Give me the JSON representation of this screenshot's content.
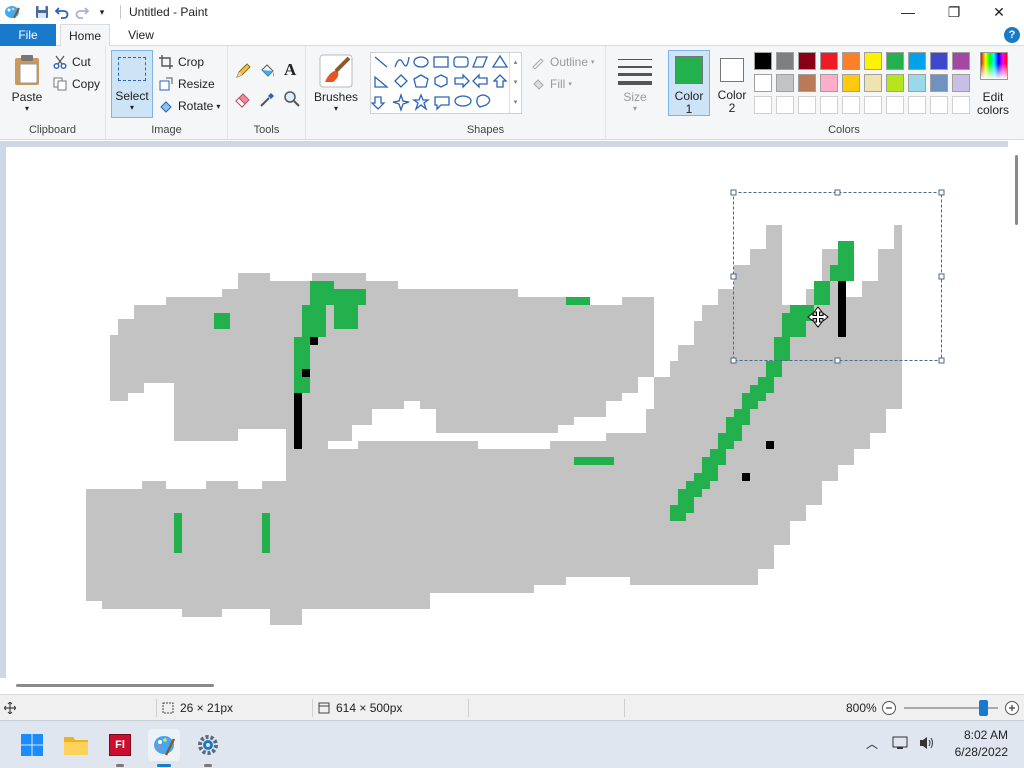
{
  "window": {
    "title": "Untitled - Paint",
    "minimize_glyph": "—",
    "restore_glyph": "❐",
    "close_glyph": "✕"
  },
  "tabs": {
    "file": "File",
    "home": "Home",
    "view": "View",
    "help": "?"
  },
  "clipboard": {
    "paste": "Paste",
    "cut": "Cut",
    "copy": "Copy",
    "label": "Clipboard"
  },
  "image": {
    "select": "Select",
    "crop": "Crop",
    "resize": "Resize",
    "rotate": "Rotate",
    "label": "Image"
  },
  "tools": {
    "label": "Tools"
  },
  "brushes": {
    "label": "Brushes"
  },
  "shapes": {
    "outline": "Outline",
    "fill": "Fill",
    "size": "Size",
    "label": "Shapes"
  },
  "colors": {
    "color1": "Color",
    "color1_num": "1",
    "color2": "Color",
    "color2_num": "2",
    "edit_line1": "Edit",
    "edit_line2": "colors",
    "label": "Colors",
    "color1_value": "#22b14c",
    "color2_value": "#ffffff",
    "palette_row1": [
      "#000000",
      "#7f7f7f",
      "#880015",
      "#ed1c24",
      "#ff7f27",
      "#fff200",
      "#22b14c",
      "#00a2e8",
      "#3f48cc",
      "#a349a4"
    ],
    "palette_row2": [
      "#ffffff",
      "#c3c3c3",
      "#b97a57",
      "#ffaec9",
      "#ffc90e",
      "#efe4b0",
      "#b5e61d",
      "#99d9ea",
      "#7092be",
      "#c8bfe7"
    ]
  },
  "canvas": {
    "bg": "#c3c3c3",
    "accent": "#22b14c"
  },
  "status": {
    "selection_size": "26 × 21px",
    "image_size": "614 × 500px",
    "zoom": "800%",
    "zoom_level": 0.8
  },
  "clock": {
    "time": "8:02 AM",
    "date": "6/28/2022"
  }
}
